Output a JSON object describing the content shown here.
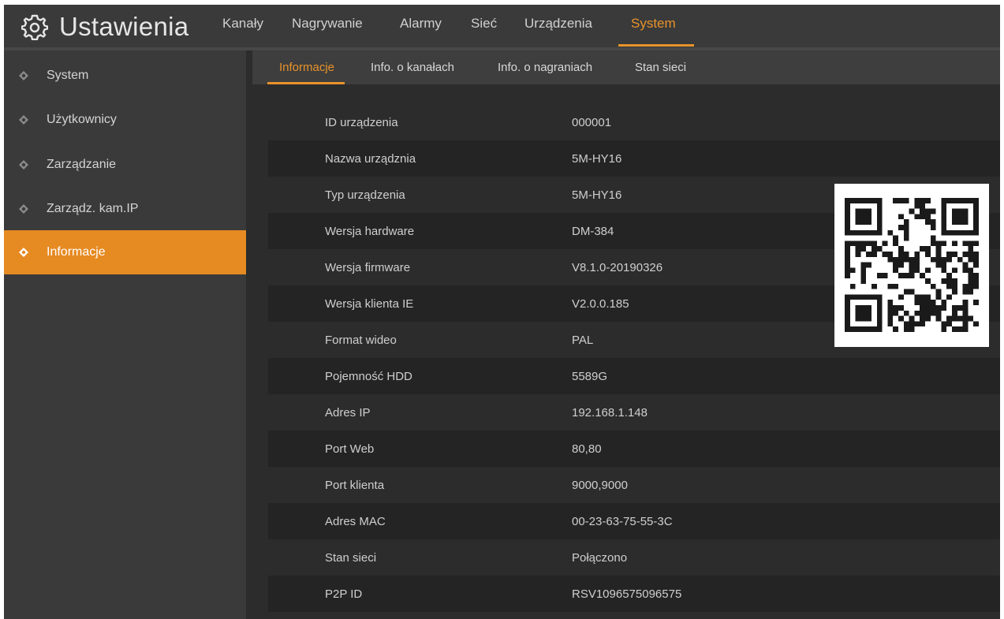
{
  "header": {
    "title": "Ustawienia",
    "title_icon": "gear-icon",
    "tabs": [
      {
        "label": "Kanały",
        "active": false
      },
      {
        "label": "Nagrywanie",
        "active": false
      },
      {
        "label": "Alarmy",
        "active": false
      },
      {
        "label": "Sieć",
        "active": false
      },
      {
        "label": "Urządzenia",
        "active": false
      },
      {
        "label": "System",
        "active": true
      }
    ]
  },
  "sidebar": {
    "items": [
      {
        "label": "System",
        "active": false
      },
      {
        "label": "Użytkownicy",
        "active": false
      },
      {
        "label": "Zarządzanie",
        "active": false
      },
      {
        "label": "Zarządz. kam.IP",
        "active": false
      },
      {
        "label": "Informacje",
        "active": true
      }
    ]
  },
  "subtabs": [
    {
      "label": "Informacje",
      "active": true
    },
    {
      "label": "Info. o kanałach",
      "active": false
    },
    {
      "label": "Info. o nagraniach",
      "active": false
    },
    {
      "label": "Stan sieci",
      "active": false
    }
  ],
  "info": {
    "rows": [
      {
        "label": "ID urządzenia",
        "value": "000001"
      },
      {
        "label": "Nazwa urządznia",
        "value": "5M-HY16"
      },
      {
        "label": "Typ urządzenia",
        "value": "5M-HY16"
      },
      {
        "label": "Wersja hardware",
        "value": "DM-384"
      },
      {
        "label": "Wersja firmware",
        "value": "V8.1.0-20190326"
      },
      {
        "label": "Wersja klienta IE",
        "value": "V2.0.0.185"
      },
      {
        "label": "Format wideo",
        "value": "PAL"
      },
      {
        "label": "Pojemność HDD",
        "value": "5589G"
      },
      {
        "label": "Adres IP",
        "value": "192.168.1.148"
      },
      {
        "label": "Port Web",
        "value": "80,80"
      },
      {
        "label": "Port klienta",
        "value": "9000,9000"
      },
      {
        "label": "Adres MAC",
        "value": "00-23-63-75-55-3C"
      },
      {
        "label": "Stan sieci",
        "value": "Połączono"
      },
      {
        "label": "P2P ID",
        "value": "RSV1096575096575"
      }
    ],
    "qr_icon": "qr-code-icon"
  },
  "colors": {
    "accent": "#e8922a",
    "sidebar_active": "#e68a22",
    "background": "#2c2c2c",
    "panel": "#3a3a3a"
  }
}
